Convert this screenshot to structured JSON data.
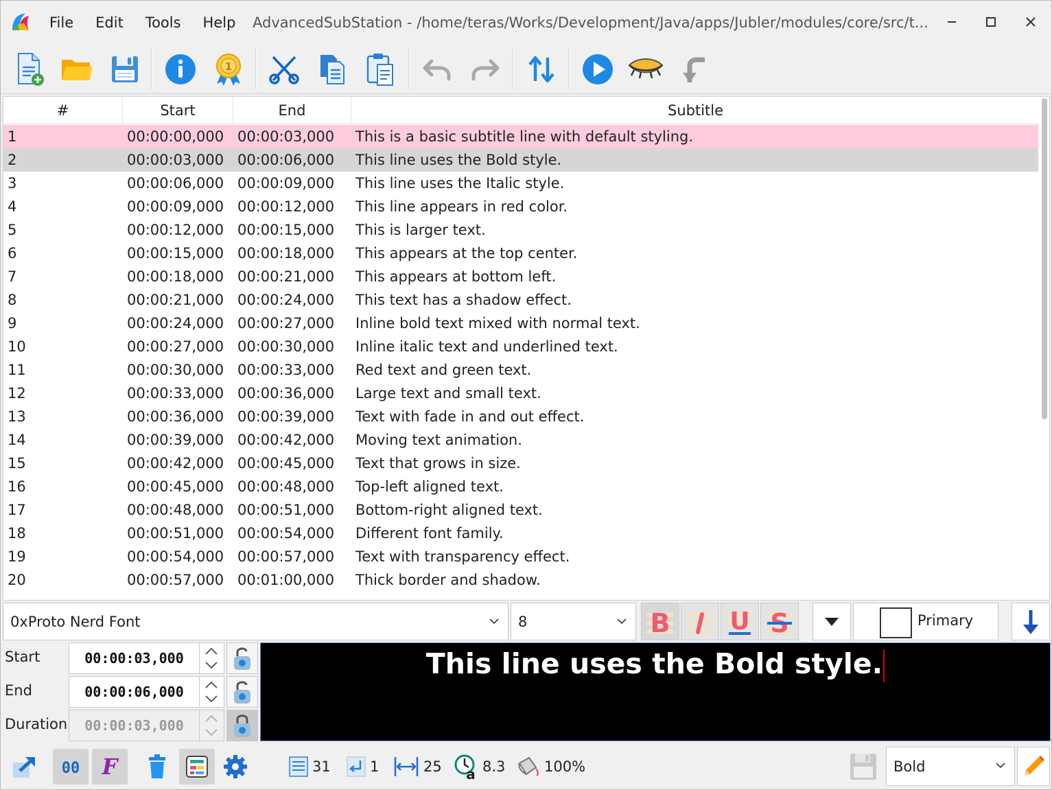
{
  "window": {
    "title": "AdvancedSubStation - /home/teras/Works/Development/Java/apps/Jubler/modules/core/src/t..."
  },
  "menu": [
    "File",
    "Edit",
    "Tools",
    "Help"
  ],
  "toolbar": {
    "icons": [
      "new-file-icon",
      "open-folder-icon",
      "save-icon",
      "info-icon",
      "award-icon",
      "cut-icon",
      "copy-icon",
      "paste-icon",
      "undo-icon",
      "redo-icon",
      "sort-icon",
      "play-icon",
      "preview-eye-icon",
      "jump-back-icon"
    ]
  },
  "table": {
    "columns": [
      "#",
      "Start",
      "End",
      "Subtitle"
    ],
    "rows": [
      [
        "1",
        "00:00:00,000",
        "00:00:03,000",
        "This is a basic subtitle line with default styling."
      ],
      [
        "2",
        "00:00:03,000",
        "00:00:06,000",
        "This line uses the Bold style."
      ],
      [
        "3",
        "00:00:06,000",
        "00:00:09,000",
        "This line uses the Italic style."
      ],
      [
        "4",
        "00:00:09,000",
        "00:00:12,000",
        "This line appears in red color."
      ],
      [
        "5",
        "00:00:12,000",
        "00:00:15,000",
        "This is larger text."
      ],
      [
        "6",
        "00:00:15,000",
        "00:00:18,000",
        "This appears at the top center."
      ],
      [
        "7",
        "00:00:18,000",
        "00:00:21,000",
        "This appears at bottom left."
      ],
      [
        "8",
        "00:00:21,000",
        "00:00:24,000",
        "This text has a shadow effect."
      ],
      [
        "9",
        "00:00:24,000",
        "00:00:27,000",
        "Inline bold text mixed with normal text."
      ],
      [
        "10",
        "00:00:27,000",
        "00:00:30,000",
        "Inline italic text and underlined text."
      ],
      [
        "11",
        "00:00:30,000",
        "00:00:33,000",
        "Red text and green text."
      ],
      [
        "12",
        "00:00:33,000",
        "00:00:36,000",
        "Large text and small text."
      ],
      [
        "13",
        "00:00:36,000",
        "00:00:39,000",
        "Text with fade in and out effect."
      ],
      [
        "14",
        "00:00:39,000",
        "00:00:42,000",
        "Moving text animation."
      ],
      [
        "15",
        "00:00:42,000",
        "00:00:45,000",
        "Text that grows in size."
      ],
      [
        "16",
        "00:00:45,000",
        "00:00:48,000",
        "Top-left aligned text."
      ],
      [
        "17",
        "00:00:48,000",
        "00:00:51,000",
        "Bottom-right aligned text."
      ],
      [
        "18",
        "00:00:51,000",
        "00:00:54,000",
        "Different font family."
      ],
      [
        "19",
        "00:00:54,000",
        "00:00:57,000",
        "Text with transparency effect."
      ],
      [
        "20",
        "00:00:57,000",
        "00:01:00,000",
        "Thick border and shadow."
      ]
    ],
    "selected_row_color": "#ffccdd",
    "highlight_row_color": "#d6d6d6"
  },
  "format": {
    "font": "0xProto Nerd Font",
    "size": "8",
    "bold_label": "B",
    "italic_label": "I",
    "underline_label": "U",
    "strike_label": "S",
    "color_label": "Primary"
  },
  "edit": {
    "start_label": "Start",
    "start_value": "00:00:03,000",
    "end_label": "End",
    "end_value": "00:00:06,000",
    "duration_label": "Duration",
    "duration_value": "00:00:03,000",
    "preview_text": "This line uses the Bold style."
  },
  "status": {
    "lines": "31",
    "newlines": "1",
    "width": "25",
    "cps": "8.3",
    "fill": "100%",
    "style": "Bold"
  }
}
